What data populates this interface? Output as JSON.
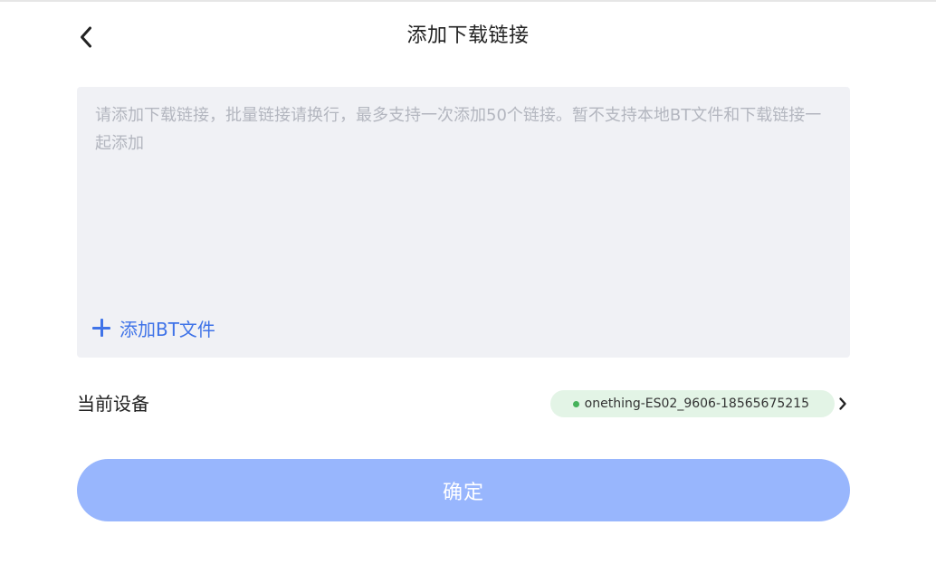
{
  "header": {
    "title": "添加下载链接",
    "back_icon": "chevron-left-icon"
  },
  "link_input": {
    "value": "",
    "placeholder": "请添加下载链接，批量链接请换行，最多支持一次添加50个链接。暂不支持本地BT文件和下载链接一起添加"
  },
  "add_bt": {
    "icon": "plus-icon",
    "label": "添加BT文件"
  },
  "device": {
    "label": "当前设备",
    "name": "onething-ES02_9606-18565675215",
    "status": "online",
    "chevron_icon": "chevron-right-icon"
  },
  "confirm": {
    "label": "确定"
  },
  "colors": {
    "accent": "#3f73e8",
    "confirm_button_bg": "#98b6fd",
    "input_bg": "#f0f1f5",
    "device_pill_bg": "#e3f4e6",
    "status_online": "#45b25a",
    "placeholder": "#b3b6bf"
  }
}
